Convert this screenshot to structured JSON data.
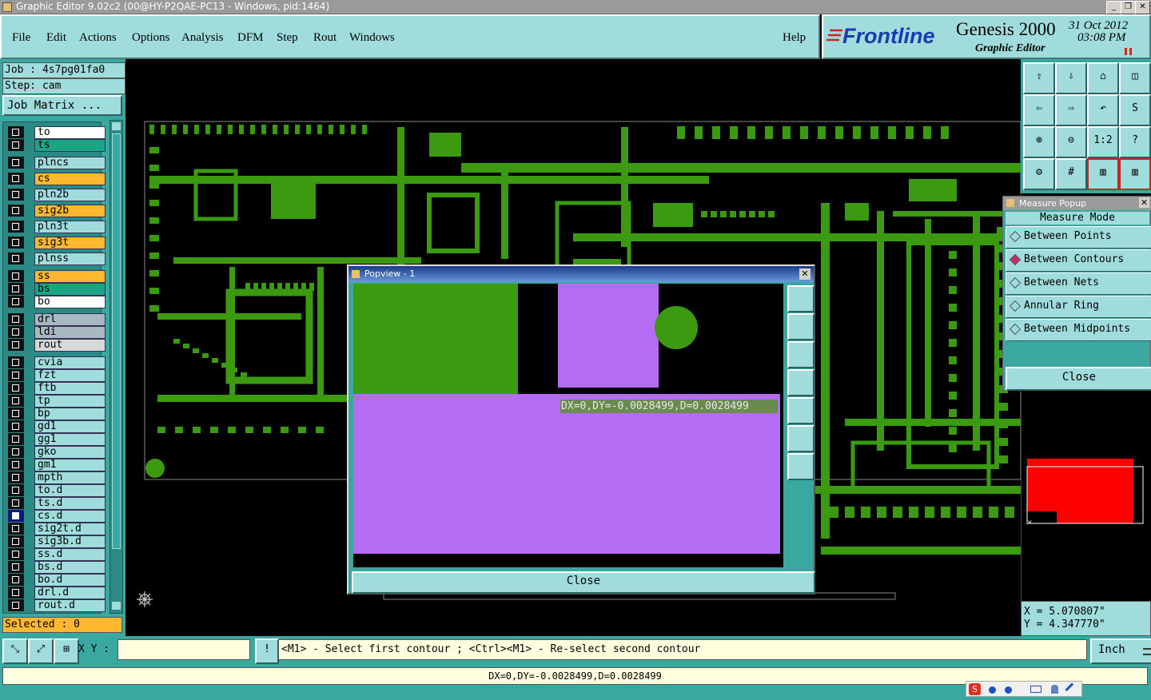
{
  "window": {
    "title": "Graphic Editor 9.02c2 (00@HY-P2QAE-PC13 - Windows, pid:1464)"
  },
  "menu": {
    "items": [
      "File",
      "Edit",
      "Actions",
      "Options",
      "Analysis",
      "DFM",
      "Step",
      "Rout",
      "Windows"
    ],
    "help": "Help"
  },
  "brand": {
    "logo": "Frontline",
    "product": "Genesis 2000",
    "subtitle": "Graphic Editor",
    "date": "31 Oct 2012",
    "time": "03:08 PM"
  },
  "job": {
    "job_label": "Job : 4s7pg01fa0",
    "step_label": "Step: cam",
    "matrix_button": "Job Matrix ..."
  },
  "layers": [
    {
      "name": "to",
      "color": "#ffffff"
    },
    {
      "name": "ts",
      "color": "#1aa585"
    },
    {
      "name": "plncs",
      "color": "#a0dcdc"
    },
    {
      "name": "cs",
      "color": "#ffb830"
    },
    {
      "name": "pln2b",
      "color": "#a0dcdc"
    },
    {
      "name": "sig2b",
      "color": "#ffb830"
    },
    {
      "name": "pln3t",
      "color": "#a0dcdc"
    },
    {
      "name": "sig3t",
      "color": "#ffb830"
    },
    {
      "name": "plnss",
      "color": "#a0dcdc"
    },
    {
      "name": "ss",
      "color": "#ffb830"
    },
    {
      "name": "bs",
      "color": "#1aa585"
    },
    {
      "name": "bo",
      "color": "#ffffff"
    },
    {
      "name": "drl",
      "color": "#a8b8c0"
    },
    {
      "name": "ldi",
      "color": "#a8b8c0"
    },
    {
      "name": "rout",
      "color": "#d8d8d8"
    },
    {
      "name": "cvia",
      "color": "#a0dcdc"
    },
    {
      "name": "fzt",
      "color": "#a0dcdc"
    },
    {
      "name": "ftb",
      "color": "#a0dcdc"
    },
    {
      "name": "tp",
      "color": "#a0dcdc"
    },
    {
      "name": "bp",
      "color": "#a0dcdc"
    },
    {
      "name": "gd1",
      "color": "#a0dcdc"
    },
    {
      "name": "gg1",
      "color": "#a0dcdc"
    },
    {
      "name": "gko",
      "color": "#a0dcdc"
    },
    {
      "name": "gm1",
      "color": "#a0dcdc"
    },
    {
      "name": "mpth",
      "color": "#a0dcdc"
    },
    {
      "name": "to.d",
      "color": "#a0dcdc"
    },
    {
      "name": "ts.d",
      "color": "#a0dcdc"
    },
    {
      "name": "cs.d",
      "color": "#a0dcdc"
    },
    {
      "name": "sig2t.d",
      "color": "#a0dcdc"
    },
    {
      "name": "sig3b.d",
      "color": "#a0dcdc"
    },
    {
      "name": "ss.d",
      "color": "#a0dcdc"
    },
    {
      "name": "bs.d",
      "color": "#a0dcdc"
    },
    {
      "name": "bo.d",
      "color": "#a0dcdc"
    },
    {
      "name": "drl.d",
      "color": "#a0dcdc"
    },
    {
      "name": "rout.d",
      "color": "#a0dcdc"
    }
  ],
  "selected": "Selected : 0",
  "measure_popup": {
    "title": "Measure Popup",
    "heading": "Measure Mode",
    "modes": [
      "Between Points",
      "Between Contours",
      "Between Nets",
      "Annular Ring",
      "Between Midpoints"
    ],
    "selected_index": 1,
    "close": "Close"
  },
  "popview": {
    "title": "Popview - 1",
    "measurement": "DX=0,DY=-0.0028499,D=0.0028499",
    "close": "Close"
  },
  "coords": {
    "x": "X = 5.070807\"",
    "y": "Y = 4.347770\""
  },
  "command": {
    "xy_label": "X Y :",
    "xy_value": "",
    "prompt": "<M1> - Select first contour ; <Ctrl><M1> - Re-select second contour",
    "units": "Inch"
  },
  "status": {
    "text": "DX=0,DY=-0.0028499,D=0.0028499"
  },
  "colors": {
    "panel": "#3aa8a0",
    "button": "#a0dcdc",
    "copper": "#3c9a10",
    "highlight": "#b46cf2",
    "overview": "#ff0000"
  }
}
